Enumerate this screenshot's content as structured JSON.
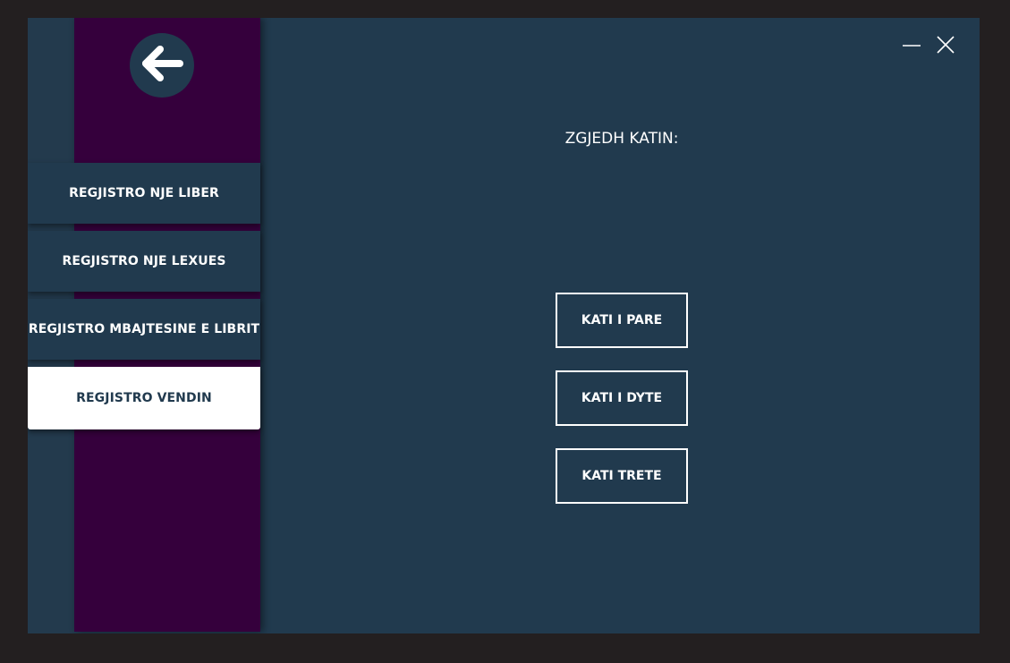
{
  "window": {
    "minimize_icon": "minimize-icon",
    "close_icon": "close-icon"
  },
  "sidebar": {
    "back_icon": "arrow-left-icon",
    "items": [
      {
        "label": "REGJISTRO NJE LIBER",
        "active": false
      },
      {
        "label": "REGJISTRO NJE LEXUES",
        "active": false
      },
      {
        "label": "REGJISTRO MBAJTESINE E LIBRIT",
        "active": false
      },
      {
        "label": "REGJISTRO VENDIN",
        "active": true
      }
    ]
  },
  "main": {
    "title": "ZGJEDH KATIN:",
    "floors": [
      {
        "label": "KATI I PARE"
      },
      {
        "label": "KATI I DYTE"
      },
      {
        "label": "KATI TRETE"
      }
    ]
  },
  "colors": {
    "background": "#213a4e",
    "sidebar": "#35003c",
    "outer": "#231f20",
    "text": "#ffffff"
  }
}
